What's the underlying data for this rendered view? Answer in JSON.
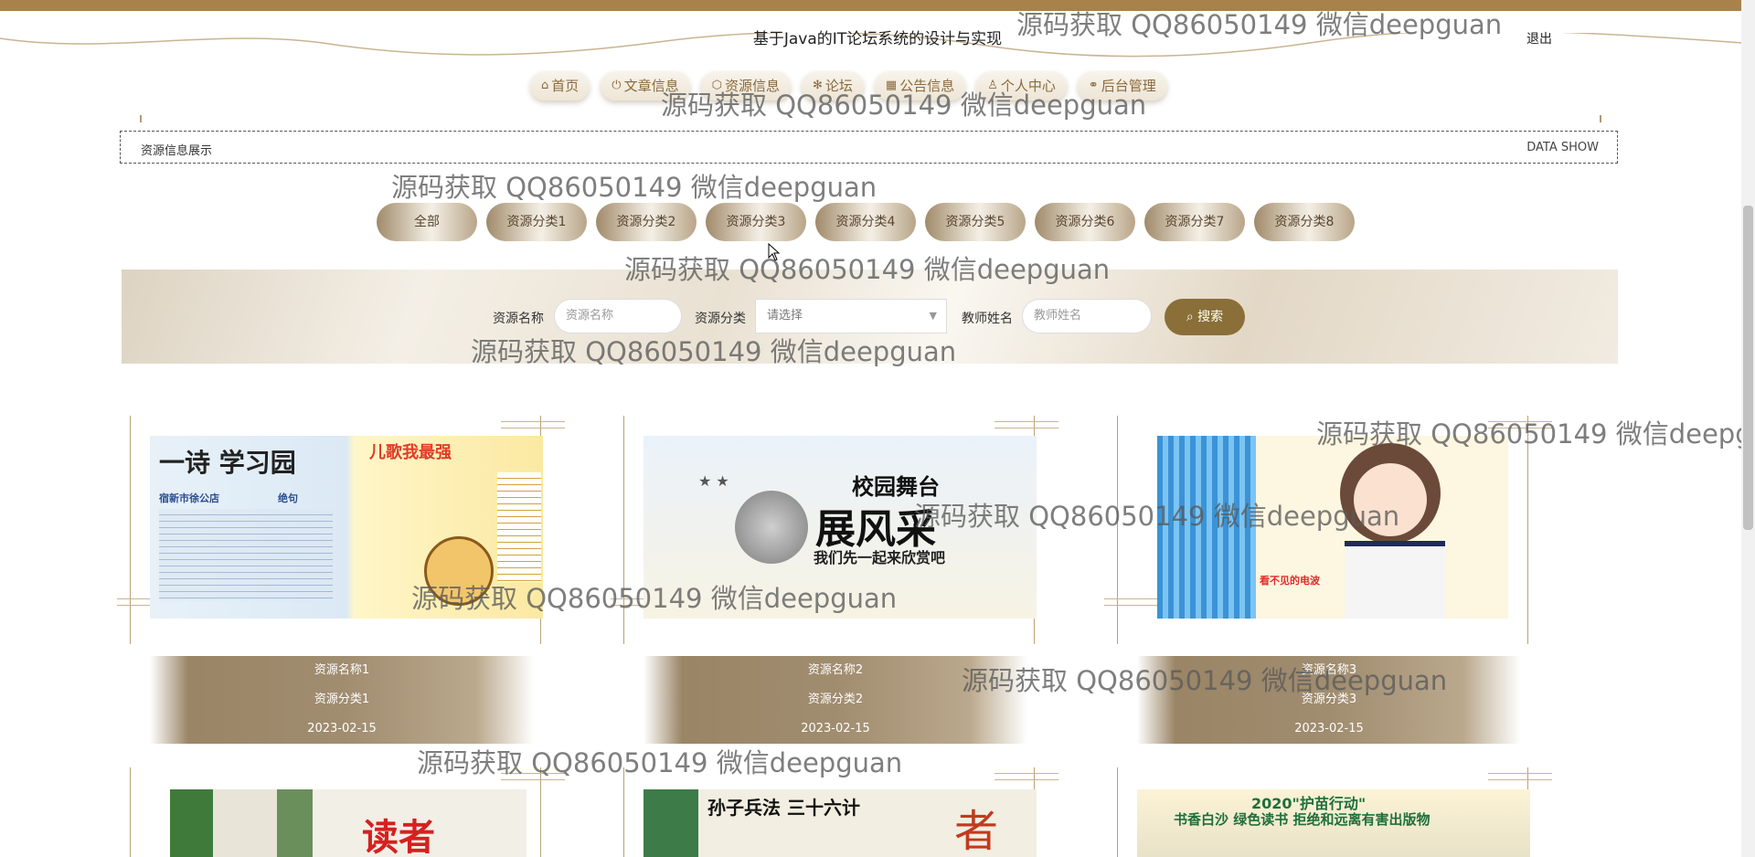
{
  "header": {
    "title": "基于Java的IT论坛系统的设计与实现",
    "logout_label": "退出"
  },
  "nav": [
    {
      "icon": "home-icon",
      "glyph": "⌂",
      "label": "首页"
    },
    {
      "icon": "power-icon",
      "glyph": "⏻",
      "label": "文章信息"
    },
    {
      "icon": "cube-icon",
      "glyph": "⬡",
      "label": "资源信息"
    },
    {
      "icon": "snowflake-icon",
      "glyph": "✻",
      "label": "论坛"
    },
    {
      "icon": "grid-icon",
      "glyph": "▦",
      "label": "公告信息"
    },
    {
      "icon": "user-icon",
      "glyph": "♙",
      "label": "个人中心"
    },
    {
      "icon": "link-icon",
      "glyph": "⚭",
      "label": "后台管理"
    }
  ],
  "section": {
    "title": "资源信息展示",
    "subtitle": "DATA SHOW"
  },
  "categories": [
    "全部",
    "资源分类1",
    "资源分类2",
    "资源分类3",
    "资源分类4",
    "资源分类5",
    "资源分类6",
    "资源分类7",
    "资源分类8"
  ],
  "search": {
    "name_label": "资源名称",
    "name_placeholder": "资源名称",
    "category_label": "资源分类",
    "category_placeholder": "请选择",
    "teacher_label": "教师姓名",
    "teacher_placeholder": "教师姓名",
    "button_label": "搜索"
  },
  "cards": [
    {
      "name": "资源名称1",
      "category": "资源分类1",
      "date": "2023-02-15",
      "image": "poem-poster-image"
    },
    {
      "name": "资源名称2",
      "category": "资源分类2",
      "date": "2023-02-15",
      "image": "campus-stage-image"
    },
    {
      "name": "资源名称3",
      "category": "资源分类3",
      "date": "2023-02-15",
      "image": "magazine-cover-image"
    },
    {
      "name": "",
      "category": "",
      "date": "",
      "image": "books-image"
    },
    {
      "name": "",
      "category": "",
      "date": "",
      "image": "art-of-war-image"
    },
    {
      "name": "",
      "category": "",
      "date": "",
      "image": "reading-banner-image"
    }
  ],
  "card_images_text": {
    "poem1": "宿新市徐公店",
    "poem2": "绝句",
    "poem3": "儿歌我最强",
    "stage1": "校园舞台",
    "stage2": "展风采",
    "stage3": "我们先一起来欣赏吧",
    "book3": "看不见的电波",
    "banner6": "2020\"护苗行动\"",
    "banner6b": "书香白沙 绿色读书 拒绝和远离有害出版物",
    "book5": "孙子兵法 三十六计"
  },
  "watermark": "源码获取 QQ86050149 微信deepguan",
  "colors": {
    "accent": "#8a6f38",
    "topbar": "#a8824a"
  }
}
